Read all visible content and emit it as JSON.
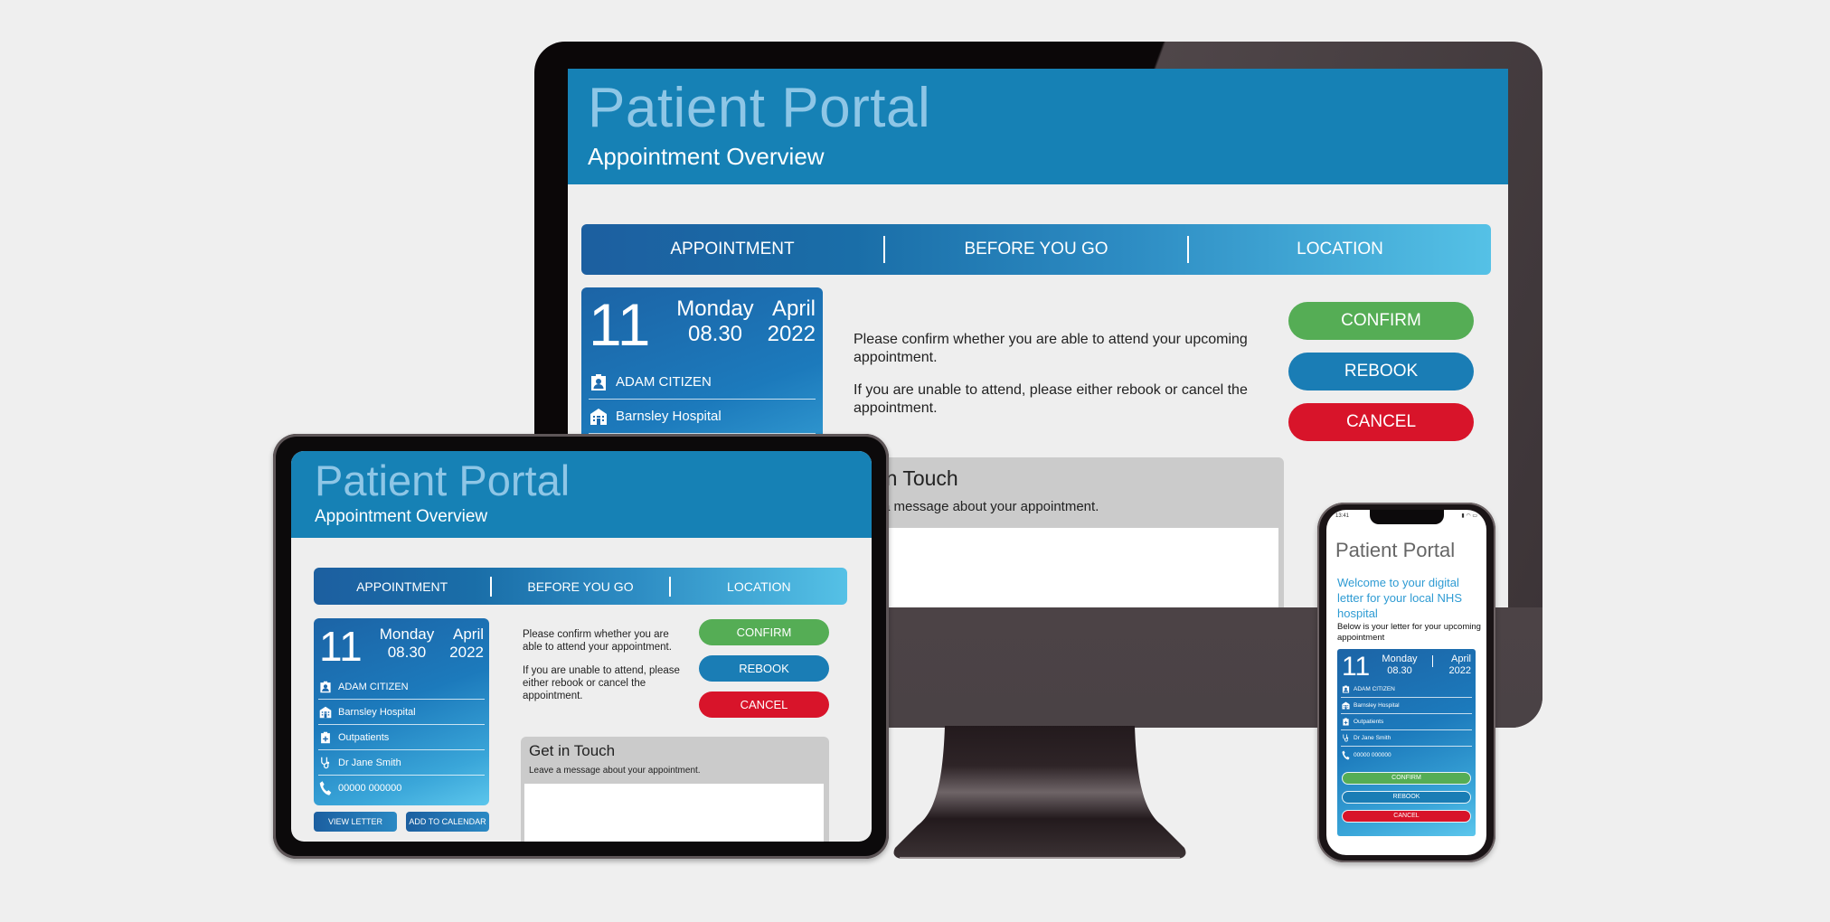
{
  "colors": {
    "header_blue": "#1681b5",
    "title_light_blue": "#8ec6e6",
    "confirm_green": "#55ad55",
    "rebook_blue": "#1a7db5",
    "cancel_red": "#d8142a",
    "panel_gray": "#cbcbcb",
    "welcome_blue": "#2e9bd3"
  },
  "desktop": {
    "title": "Patient Portal",
    "subtitle": "Appointment Overview",
    "tabs": [
      "APPOINTMENT",
      "BEFORE YOU GO",
      "LOCATION"
    ],
    "appointment": {
      "day": "11",
      "weekday": "Monday",
      "time": "08.30",
      "month": "April",
      "year": "2022",
      "details": [
        {
          "icon": "patient-badge-icon",
          "text": "ADAM CITIZEN"
        },
        {
          "icon": "hospital-icon",
          "text": "Barnsley Hospital"
        }
      ]
    },
    "message": [
      "Please confirm whether you are able to attend your upcoming appointment.",
      "If you are unable to attend, please either rebook or cancel the appointment."
    ],
    "buttons": {
      "confirm": "CONFIRM",
      "rebook": "REBOOK",
      "cancel": "CANCEL"
    },
    "get_in_touch": {
      "title": "Get in Touch",
      "subtitle": "Leave a message about your appointment.",
      "message_value": ""
    }
  },
  "tablet": {
    "title": "Patient Portal",
    "subtitle": "Appointment Overview",
    "tabs": [
      "APPOINTMENT",
      "BEFORE YOU GO",
      "LOCATION"
    ],
    "appointment": {
      "day": "11",
      "weekday": "Monday",
      "time": "08.30",
      "month": "April",
      "year": "2022",
      "details": [
        {
          "icon": "patient-badge-icon",
          "text": "ADAM CITIZEN"
        },
        {
          "icon": "hospital-icon",
          "text": "Barnsley Hospital"
        },
        {
          "icon": "clipboard-icon",
          "text": "Outpatients"
        },
        {
          "icon": "stethoscope-icon",
          "text": "Dr Jane Smith"
        },
        {
          "icon": "phone-icon",
          "text": "00000 000000"
        }
      ]
    },
    "card_buttons": {
      "view_letter": "VIEW LETTER",
      "add_to_calendar": "ADD TO CALENDAR"
    },
    "message": [
      "Please confirm whether you are able to attend your appointment.",
      "If you are unable to attend, please either rebook or cancel the appointment."
    ],
    "buttons": {
      "confirm": "CONFIRM",
      "rebook": "REBOOK",
      "cancel": "CANCEL"
    },
    "get_in_touch": {
      "title": "Get in Touch",
      "subtitle": "Leave a message about your appointment.",
      "message_value": ""
    }
  },
  "phone": {
    "status_time": "13:41",
    "title": "Patient Portal",
    "welcome": "Welcome to your digital letter for your local NHS hospital",
    "intro": "Below is your letter for your upcoming appointment",
    "appointment": {
      "day": "11",
      "weekday": "Monday",
      "time": "08.30",
      "month": "April",
      "year": "2022",
      "details": [
        {
          "icon": "patient-badge-icon",
          "text": "ADAM CITIZEN"
        },
        {
          "icon": "hospital-icon",
          "text": "Barnsley Hospital"
        },
        {
          "icon": "clipboard-icon",
          "text": "Outpatients"
        },
        {
          "icon": "stethoscope-icon",
          "text": "Dr Jane Smith"
        },
        {
          "icon": "phone-icon",
          "text": "00000 000000"
        }
      ]
    },
    "buttons": {
      "confirm": "CONFIRM",
      "rebook": "REBOOK",
      "cancel": "CANCEL"
    }
  }
}
